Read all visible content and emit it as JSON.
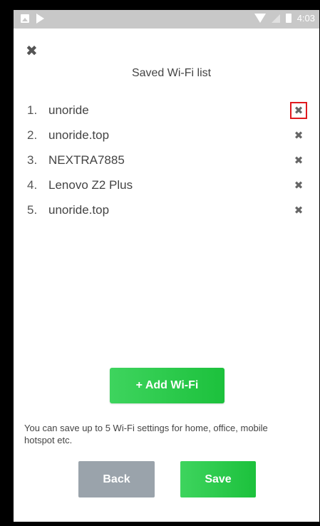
{
  "status_bar": {
    "time": "4:03",
    "icons": [
      "image-icon",
      "play-store-icon",
      "wifi-icon",
      "signal-icon",
      "battery-icon"
    ]
  },
  "header": {
    "close_icon": "✖",
    "title": "Saved Wi-Fi list"
  },
  "wifi_list": [
    {
      "number": "1.",
      "name": "unoride",
      "delete_icon": "✖"
    },
    {
      "number": "2.",
      "name": "unoride.top",
      "delete_icon": "✖"
    },
    {
      "number": "3.",
      "name": "NEXTRA7885",
      "delete_icon": "✖"
    },
    {
      "number": "4.",
      "name": "Lenovo Z2 Plus",
      "delete_icon": "✖"
    },
    {
      "number": "5.",
      "name": "unoride.top",
      "delete_icon": "✖"
    }
  ],
  "add_button": {
    "label": "+ Add Wi-Fi"
  },
  "info_text": "You can save up to 5 Wi-Fi settings for home, office, mobile hotspot etc.",
  "footer": {
    "back_label": "Back",
    "save_label": "Save"
  },
  "colors": {
    "accent_green": "#2ecc4f",
    "back_gray": "#9aa3ab",
    "highlight_red": "#e0191e"
  }
}
